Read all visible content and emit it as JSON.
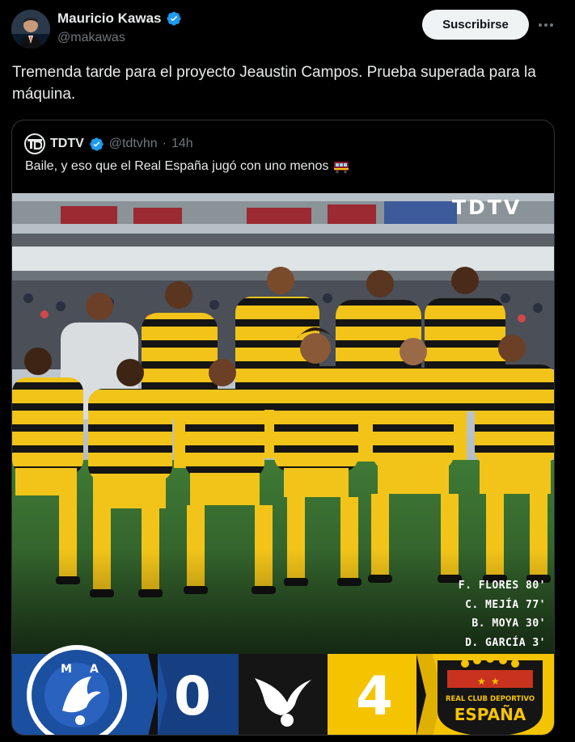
{
  "post": {
    "author_name": "Mauricio Kawas",
    "author_handle": "@makawas",
    "subscribe_label": "Suscribirse",
    "more_icon": "more-icon",
    "text": "Tremenda tarde para el proyecto Jeaustin Campos. Prueba superada para la máquina."
  },
  "quote": {
    "name": "TDTV",
    "handle": "@tdtvhn",
    "dot": "·",
    "time": "14h",
    "text": "Baile, y eso que el Real España jugó con uno menos",
    "emoji_icon": "train-icon"
  },
  "media": {
    "watermark": "TDTV",
    "scorers": [
      "F. FLORES 80'",
      "C. MEJÍA 77'",
      "B. MOYA 30'",
      "D. GARCÍA 3'"
    ],
    "home_score": "0",
    "away_score": "4",
    "away_crest_text": "REAL CLUB DEPORTIVO",
    "away_crest_name": "ESPAÑA",
    "colors": {
      "home_blue": "#1b4fa0",
      "away_yellow": "#f5c400",
      "kit_yellow": "#f2c419",
      "kit_black": "#151515"
    }
  }
}
